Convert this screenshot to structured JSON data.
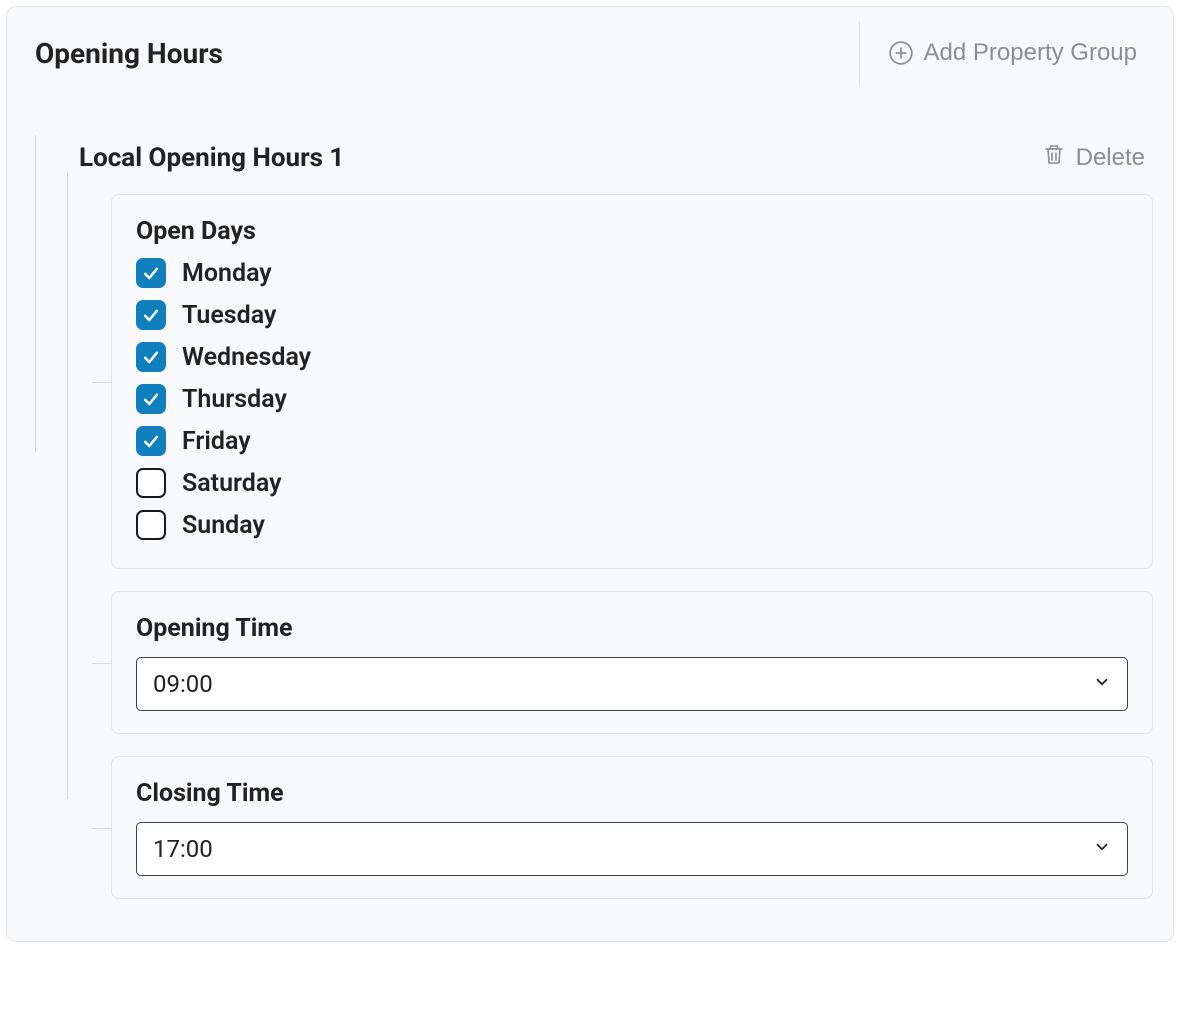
{
  "panel": {
    "title": "Opening Hours",
    "add_group_label": "Add Property Group"
  },
  "group": {
    "title": "Local Opening Hours 1",
    "delete_label": "Delete"
  },
  "open_days": {
    "label": "Open Days",
    "items": [
      {
        "label": "Monday",
        "checked": true
      },
      {
        "label": "Tuesday",
        "checked": true
      },
      {
        "label": "Wednesday",
        "checked": true
      },
      {
        "label": "Thursday",
        "checked": true
      },
      {
        "label": "Friday",
        "checked": true
      },
      {
        "label": "Saturday",
        "checked": false
      },
      {
        "label": "Sunday",
        "checked": false
      }
    ]
  },
  "opening_time": {
    "label": "Opening Time",
    "value": "09:00"
  },
  "closing_time": {
    "label": "Closing Time",
    "value": "17:00"
  },
  "colors": {
    "accent": "#107fbd",
    "muted_text": "#8a8f94",
    "border": "#e2e4e6",
    "panel_bg": "#f8f9fa"
  }
}
